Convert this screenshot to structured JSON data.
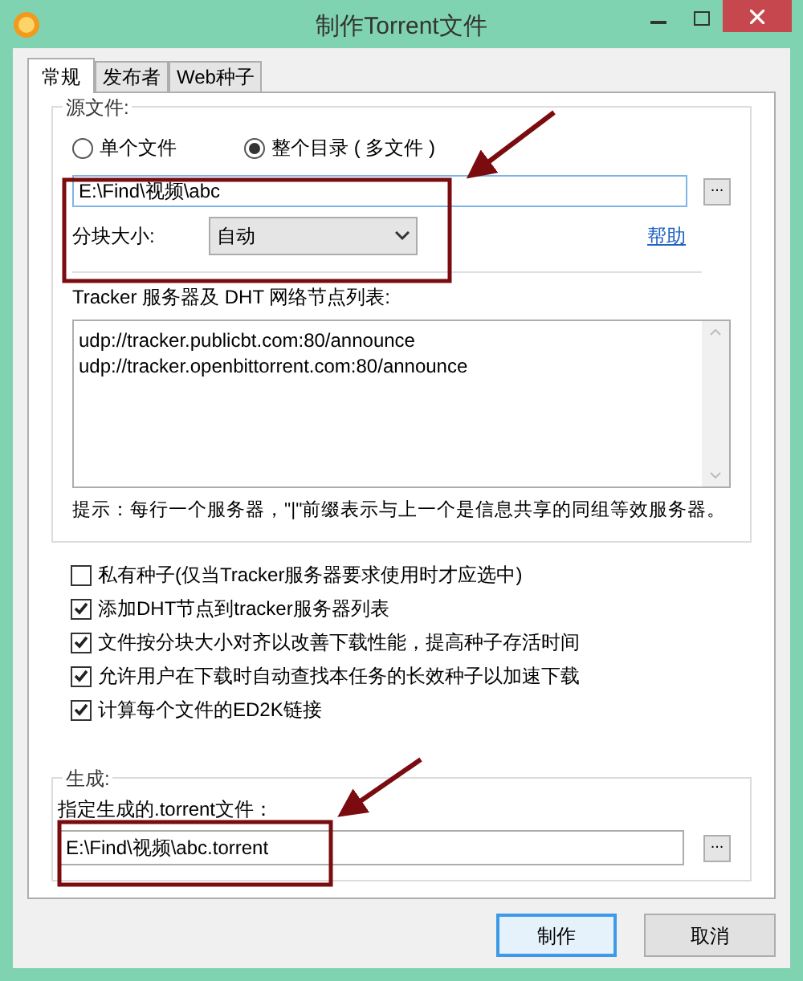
{
  "window": {
    "title": "制作Torrent文件"
  },
  "tabs": [
    {
      "label": "常规",
      "selected": true
    },
    {
      "label": "发布者",
      "selected": false
    },
    {
      "label": "Web种子",
      "selected": false
    }
  ],
  "source": {
    "title": "源文件:",
    "options": [
      {
        "label": "单个文件",
        "selected": false
      },
      {
        "label": "整个目录 ( 多文件 )",
        "selected": true
      }
    ],
    "path": "E:\\Find\\视频\\abc",
    "browse": "...",
    "piece_size_label": "分块大小:",
    "piece_size": "自动",
    "help": "帮助",
    "tracker_label": "Tracker 服务器及 DHT 网络节点列表:",
    "trackers": [
      "udp://tracker.publicbt.com:80/announce",
      "udp://tracker.openbittorrent.com:80/announce"
    ],
    "hint": "提示：每行一个服务器，\"|\"前缀表示与上一个是信息共享的同组等效服务器。",
    "options2": [
      {
        "label": "私有种子(仅当Tracker服务器要求使用时才应选中)",
        "checked": false
      },
      {
        "label": "添加DHT节点到tracker服务器列表",
        "checked": true
      },
      {
        "label": "文件按分块大小对齐以改善下载性能，提高种子存活时间",
        "checked": true
      },
      {
        "label": "允许用户在下载时自动查找本任务的长效种子以加速下载",
        "checked": true
      },
      {
        "label": "计算每个文件的ED2K链接",
        "checked": true
      }
    ]
  },
  "output": {
    "title": "生成:",
    "label": "指定生成的.torrent文件：",
    "path": "E:\\Find\\视频\\abc.torrent",
    "browse": "..."
  },
  "buttons": [
    {
      "label": "制作",
      "selected": true
    },
    {
      "label": "取消",
      "selected": false
    }
  ]
}
